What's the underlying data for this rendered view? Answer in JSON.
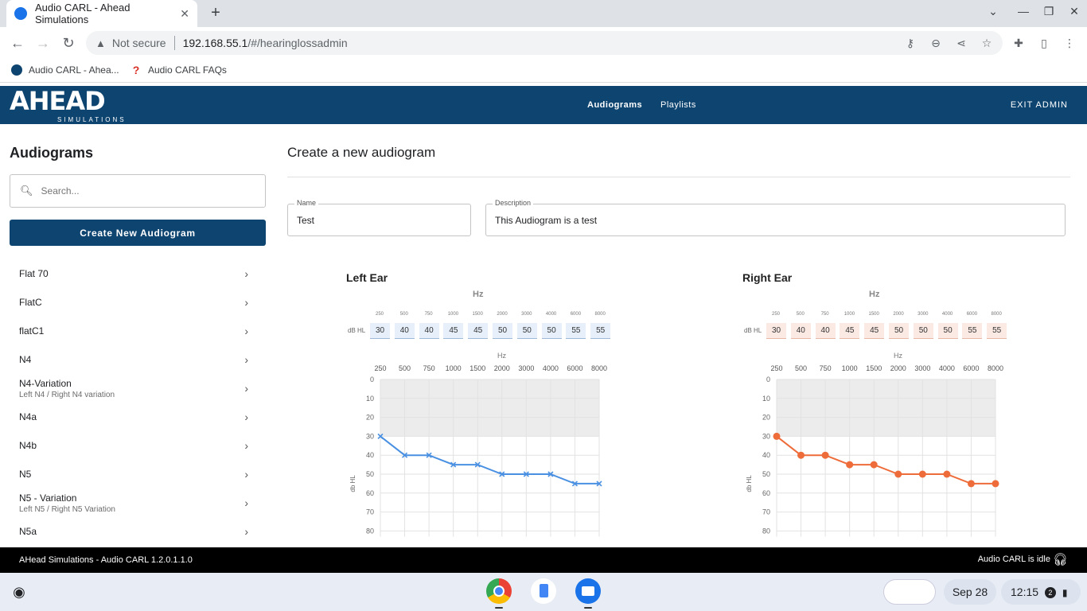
{
  "browser": {
    "tab_title": "Audio CARL - Ahead Simulations",
    "not_secure": "Not secure",
    "url_host": "192.168.55.1",
    "url_path": "/#/hearinglossadmin",
    "bookmarks": [
      {
        "label": "Audio CARL - Ahea..."
      },
      {
        "label": "Audio CARL FAQs"
      }
    ]
  },
  "app": {
    "logo_big": "AHEAD",
    "logo_small": "SIMULATIONS",
    "nav": [
      {
        "label": "Audiograms"
      },
      {
        "label": "Playlists"
      }
    ],
    "exit_label": "EXIT ADMIN"
  },
  "sidebar": {
    "title": "Audiograms",
    "search_placeholder": "Search...",
    "create_label": "Create New Audiogram",
    "items": [
      {
        "name": "Flat 70",
        "sub": ""
      },
      {
        "name": "FlatC",
        "sub": ""
      },
      {
        "name": "flatC1",
        "sub": ""
      },
      {
        "name": "N4",
        "sub": ""
      },
      {
        "name": "N4-Variation",
        "sub": "Left N4 / Right N4 variation"
      },
      {
        "name": "N4a",
        "sub": ""
      },
      {
        "name": "N4b",
        "sub": ""
      },
      {
        "name": "N5",
        "sub": ""
      },
      {
        "name": "N5 - Variation",
        "sub": "Left N5 / Right N5 Variation"
      },
      {
        "name": "N5a",
        "sub": ""
      }
    ]
  },
  "main": {
    "title": "Create a new audiogram",
    "name_label": "Name",
    "name_value": "Test",
    "desc_label": "Description",
    "desc_value": "This Audiogram is a test",
    "hz_label": "Hz",
    "dbhl_label": "dB HL",
    "left": {
      "title": "Left Ear",
      "color": "#4a90e2"
    },
    "right": {
      "title": "Right Ear",
      "color": "#ee6c3a"
    }
  },
  "chart_data": [
    {
      "type": "line",
      "title": "Left Ear",
      "xlabel": "Hz",
      "ylabel": "db HL",
      "categories": [
        "250",
        "500",
        "750",
        "1000",
        "1500",
        "2000",
        "3000",
        "4000",
        "6000",
        "8000"
      ],
      "series": [
        {
          "values": [
            30,
            40,
            40,
            45,
            45,
            50,
            50,
            50,
            55,
            55
          ]
        }
      ],
      "yticks": [
        0,
        10,
        20,
        30,
        40,
        50,
        60,
        70,
        80
      ],
      "marker": "x",
      "color": "#4a90e2"
    },
    {
      "type": "line",
      "title": "Right Ear",
      "xlabel": "Hz",
      "ylabel": "db HL",
      "categories": [
        "250",
        "500",
        "750",
        "1000",
        "1500",
        "2000",
        "3000",
        "4000",
        "6000",
        "8000"
      ],
      "series": [
        {
          "values": [
            30,
            40,
            40,
            45,
            45,
            50,
            50,
            50,
            55,
            55
          ]
        }
      ],
      "yticks": [
        0,
        10,
        20,
        30,
        40,
        50,
        60,
        70,
        80
      ],
      "marker": "circle",
      "color": "#ee6c3a"
    }
  ],
  "footer": {
    "version": "AHead Simulations - Audio CARL 1.2.0.1.1.0",
    "status": "Audio CARL is idle"
  },
  "shelf": {
    "date": "Sep 28",
    "time": "12:15",
    "notifications": "2"
  }
}
